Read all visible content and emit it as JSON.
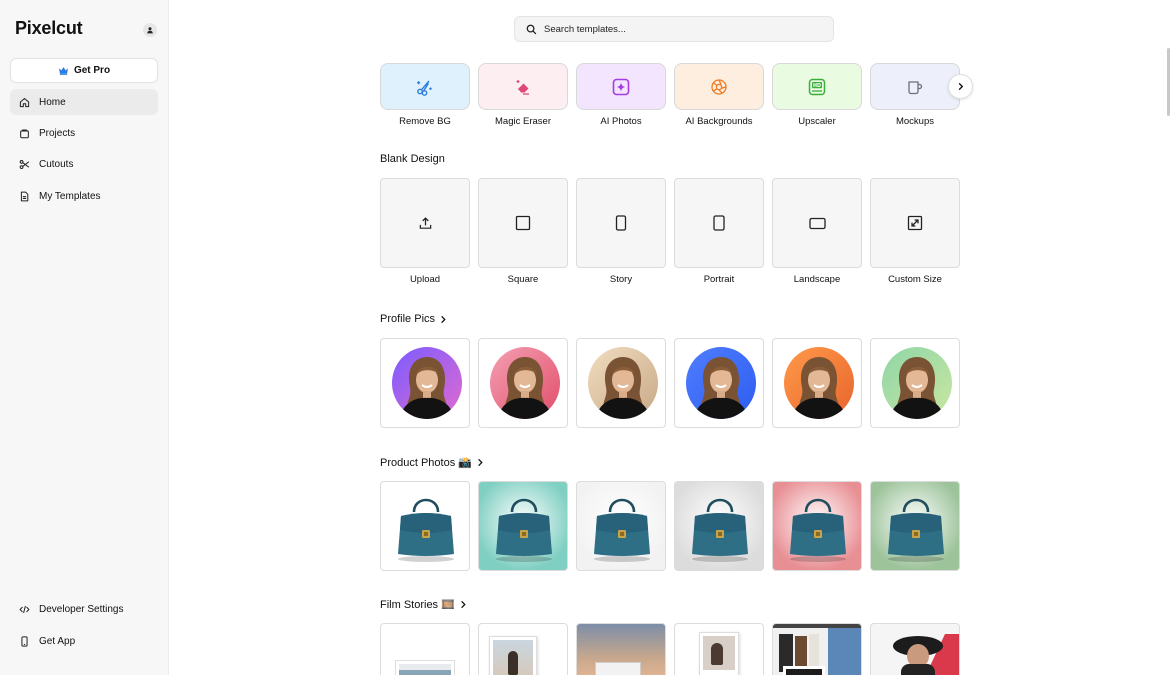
{
  "app": {
    "name": "Pixelcut"
  },
  "sidebar": {
    "get_pro_label": "Get Pro",
    "items": [
      {
        "label": "Home",
        "icon": "home-icon",
        "active": true
      },
      {
        "label": "Projects",
        "icon": "bag-icon"
      },
      {
        "label": "Cutouts",
        "icon": "scissors-icon"
      },
      {
        "label": "My Templates",
        "icon": "document-icon"
      }
    ],
    "bottom_items": [
      {
        "label": "Developer Settings",
        "icon": "code-icon"
      },
      {
        "label": "Get App",
        "icon": "phone-icon"
      }
    ]
  },
  "search": {
    "placeholder": "Search templates..."
  },
  "tools": [
    {
      "label": "Remove BG",
      "icon": "scissors-sparkle-icon",
      "bg": "#dff1fc",
      "color": "#2b7de0"
    },
    {
      "label": "Magic Eraser",
      "icon": "eraser-icon",
      "bg": "#fdeef2",
      "color": "#e0487a"
    },
    {
      "label": "AI Photos",
      "icon": "sparkle-square-icon",
      "bg": "#f3e5fd",
      "color": "#a43de0"
    },
    {
      "label": "AI Backgrounds",
      "icon": "aperture-icon",
      "bg": "#fdeedf",
      "color": "#ee7b23"
    },
    {
      "label": "Upscaler",
      "icon": "hd-icon",
      "bg": "#e9fbe0",
      "color": "#3cae3c"
    },
    {
      "label": "Mockups",
      "icon": "mug-icon",
      "bg": "#edf0fb",
      "color": "#6a6f7a"
    }
  ],
  "blank_design": {
    "title": "Blank Design",
    "items": [
      {
        "label": "Upload",
        "icon": "upload-icon"
      },
      {
        "label": "Square",
        "icon": "square-icon"
      },
      {
        "label": "Story",
        "icon": "story-icon"
      },
      {
        "label": "Portrait",
        "icon": "portrait-icon"
      },
      {
        "label": "Landscape",
        "icon": "landscape-icon"
      },
      {
        "label": "Custom Size",
        "icon": "resize-icon"
      }
    ]
  },
  "profile_pics": {
    "title": "Profile Pics",
    "gradients": [
      [
        "#7b5cff",
        "#e06ad0"
      ],
      [
        "#f3a0b2",
        "#e24d6a"
      ],
      [
        "#f2dcc0",
        "#c7a986"
      ],
      [
        "#4f7dff",
        "#2d5df0"
      ],
      [
        "#ff9a4a",
        "#e8642c"
      ],
      [
        "#8fd6a8",
        "#c9e6a0"
      ]
    ]
  },
  "product_photos": {
    "title": "Product Photos 📸",
    "backgrounds": [
      "#ffffff",
      "#7fcfc2",
      "#f2f2f2",
      "#dcdcdc",
      "#e88f94",
      "#9cc39a"
    ]
  },
  "film_stories": {
    "title": "Film Stories 🎞️"
  },
  "colors": {
    "sidebar_bg": "#f7f7f7",
    "accent_blue": "#2b7de0"
  }
}
